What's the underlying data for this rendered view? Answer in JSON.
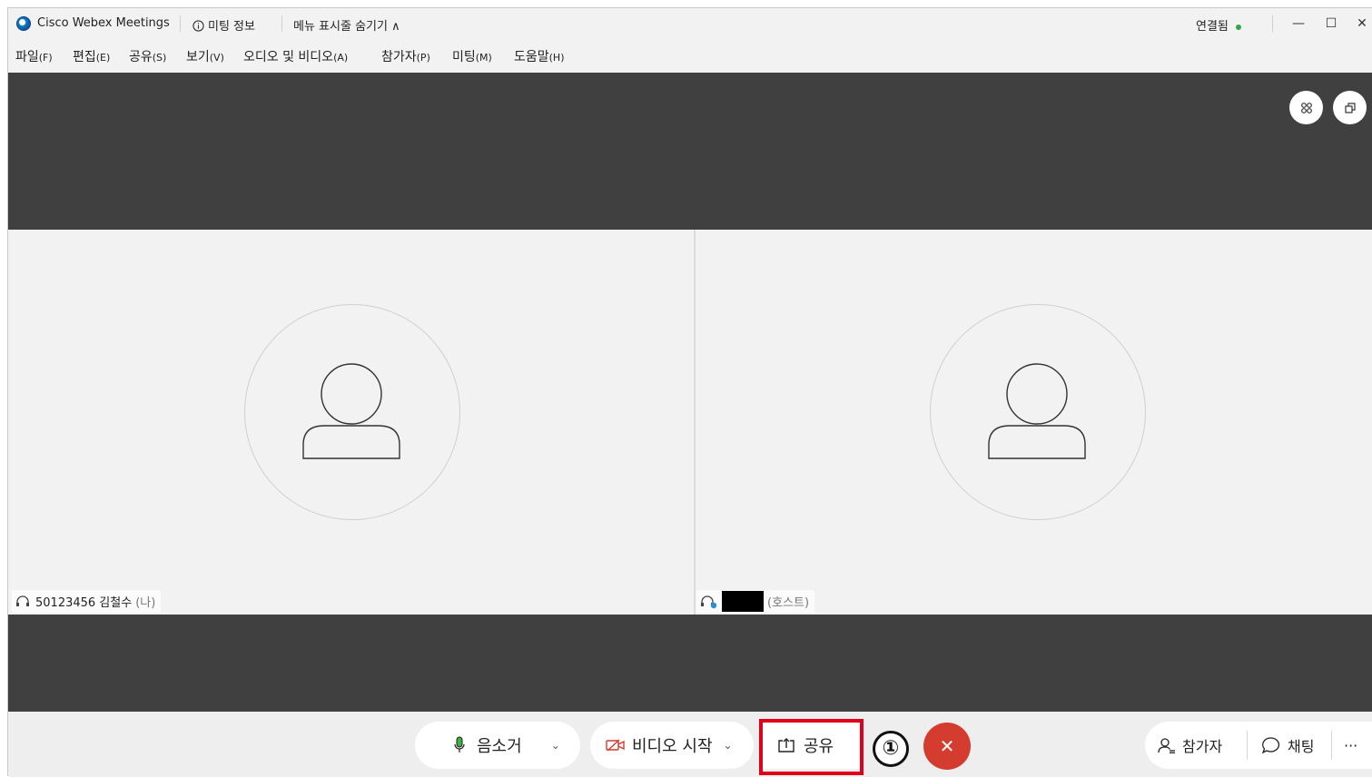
{
  "titlebar": {
    "app_title": "Cisco Webex Meetings",
    "meeting_info": "미팅 정보",
    "hide_menu": "메뉴 표시줄 숨기기 ∧",
    "connection_status": "연결됨",
    "status_color": "#2fa84a"
  },
  "menubar": {
    "items": [
      {
        "label": "파일",
        "accel": "(F)"
      },
      {
        "label": "편집",
        "accel": "(E)"
      },
      {
        "label": "공유",
        "accel": "(S)"
      },
      {
        "label": "보기",
        "accel": "(V)"
      },
      {
        "label": "오디오 및 비디오",
        "accel": "(A)"
      },
      {
        "label": "참가자",
        "accel": "(P)"
      },
      {
        "label": "미팅",
        "accel": "(M)"
      },
      {
        "label": "도움말",
        "accel": "(H)"
      }
    ]
  },
  "participants": [
    {
      "name": "50123456 김철수",
      "role": "(나)",
      "icon": "headset-icon"
    },
    {
      "name": "",
      "role": "(호스트)",
      "icon": "host-headset-icon",
      "redacted": true
    }
  ],
  "controls": {
    "mute_label": "음소거",
    "video_label": "비디오 시작",
    "share_label": "공유",
    "annotation_number": "①",
    "end_icon": "close-icon",
    "end_color": "#d33c2e",
    "highlight_color": "#e0001b",
    "participants_label": "참가자",
    "chat_label": "채팅",
    "more_label": "···"
  }
}
